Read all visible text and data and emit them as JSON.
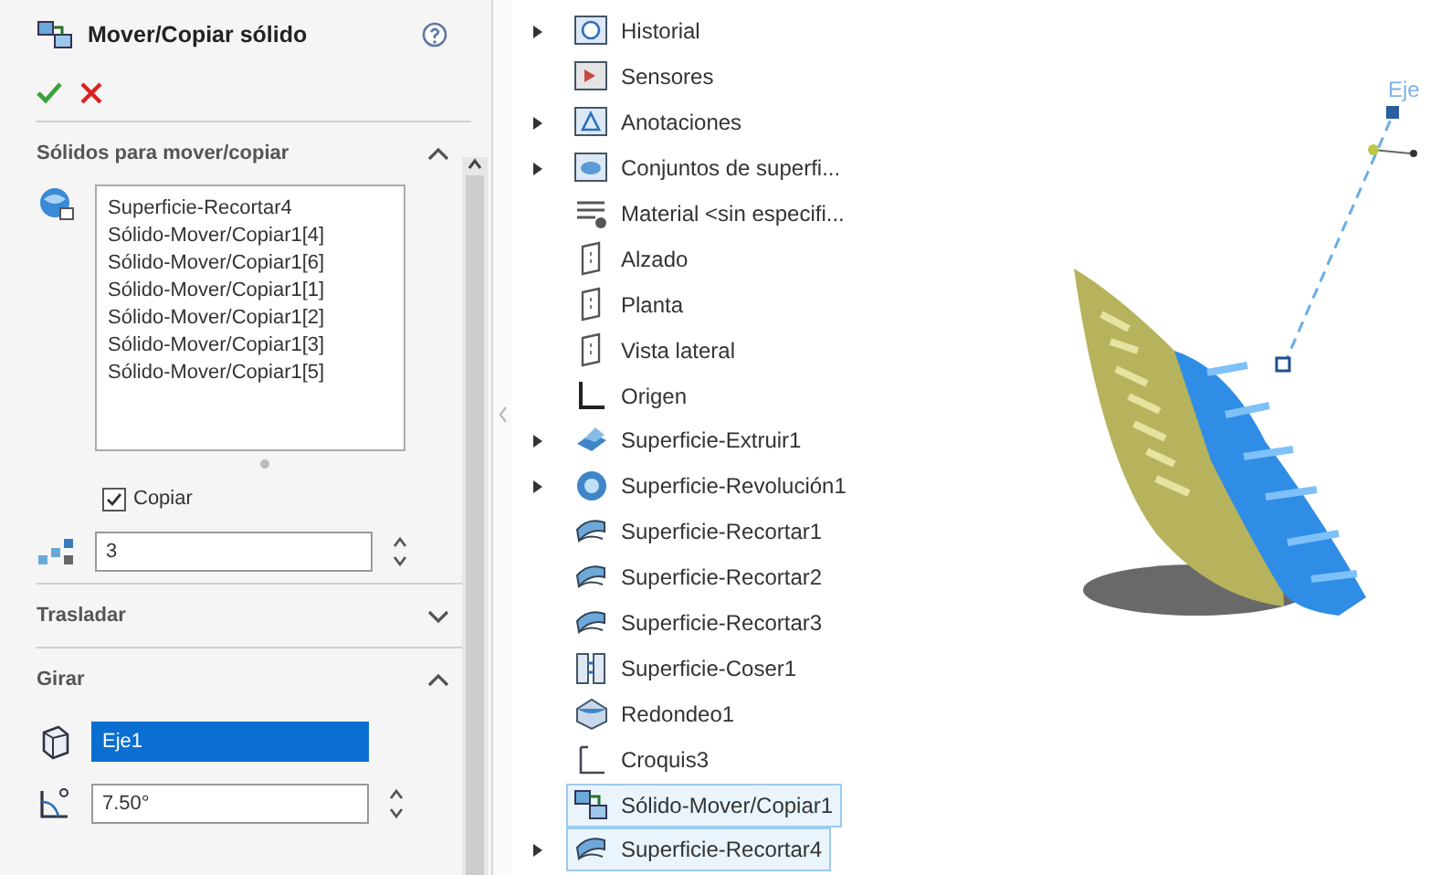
{
  "property_manager": {
    "title": "Mover/Copiar sólido",
    "sections": [
      {
        "kind": "bodies",
        "title": "Sólidos para mover/copiar",
        "expanded": true,
        "bodies": [
          "Superficie-Recortar4",
          "Sólido-Mover/Copiar1[4]",
          "Sólido-Mover/Copiar1[6]",
          "Sólido-Mover/Copiar1[1]",
          "Sólido-Mover/Copiar1[2]",
          "Sólido-Mover/Copiar1[3]",
          "Sólido-Mover/Copiar1[5]"
        ],
        "copy": {
          "label": "Copiar",
          "checked": true
        },
        "count": "3"
      },
      {
        "kind": "translate",
        "title": "Trasladar",
        "expanded": false
      },
      {
        "kind": "rotate",
        "title": "Girar",
        "expanded": true,
        "axis": {
          "value": "Eje1",
          "active": true
        },
        "angle": "7.50°"
      }
    ]
  },
  "feature_tree": {
    "items": [
      {
        "label": "Historial",
        "kind": "history",
        "expandable": true,
        "selected": false
      },
      {
        "label": "Sensores",
        "kind": "sensor",
        "expandable": false,
        "selected": false
      },
      {
        "label": "Anotaciones",
        "kind": "annotation",
        "expandable": true,
        "selected": false
      },
      {
        "label": "Conjuntos de superfi...",
        "kind": "surface-folder",
        "expandable": true,
        "selected": false
      },
      {
        "label": "Material <sin especifi...",
        "kind": "material",
        "expandable": false,
        "selected": false
      },
      {
        "label": "Alzado",
        "kind": "plane",
        "expandable": false,
        "selected": false
      },
      {
        "label": "Planta",
        "kind": "plane",
        "expandable": false,
        "selected": false
      },
      {
        "label": "Vista lateral",
        "kind": "plane",
        "expandable": false,
        "selected": false
      },
      {
        "label": "Origen",
        "kind": "origin",
        "expandable": false,
        "selected": false
      },
      {
        "label": "Superficie-Extruir1",
        "kind": "extrude",
        "expandable": true,
        "selected": false
      },
      {
        "label": "Superficie-Revolución1",
        "kind": "revolve",
        "expandable": true,
        "selected": false
      },
      {
        "label": "Superficie-Recortar1",
        "kind": "trim",
        "expandable": false,
        "selected": false
      },
      {
        "label": "Superficie-Recortar2",
        "kind": "trim",
        "expandable": false,
        "selected": false
      },
      {
        "label": "Superficie-Recortar3",
        "kind": "trim",
        "expandable": false,
        "selected": false
      },
      {
        "label": "Superficie-Coser1",
        "kind": "knit",
        "expandable": false,
        "selected": false
      },
      {
        "label": "Redondeo1",
        "kind": "fillet",
        "expandable": false,
        "selected": false
      },
      {
        "label": "Croquis3",
        "kind": "sketch",
        "expandable": false,
        "selected": false
      },
      {
        "label": "Sólido-Mover/Copiar1",
        "kind": "move-copy",
        "expandable": false,
        "selected": true
      },
      {
        "label": "Superficie-Recortar4",
        "kind": "trim",
        "expandable": true,
        "selected": true
      }
    ]
  },
  "viewport": {
    "axis_label": "Eje"
  }
}
